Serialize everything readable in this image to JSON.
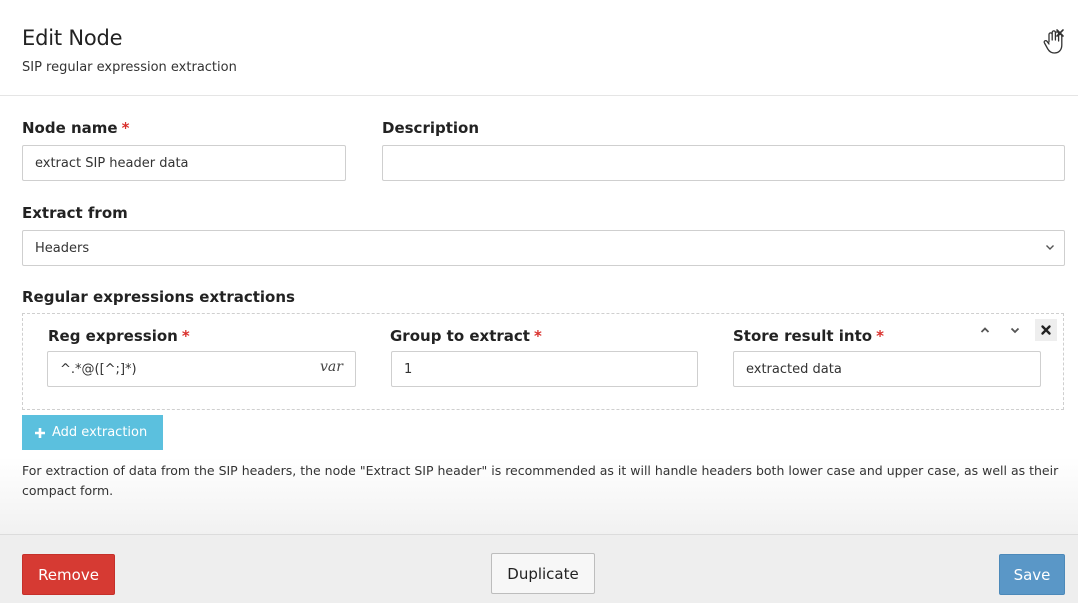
{
  "header": {
    "title": "Edit Node",
    "subtitle": "SIP regular expression extraction",
    "close_icon": "hand-pointer-close-icon"
  },
  "form": {
    "node_name": {
      "label": "Node name",
      "required_mark": "*",
      "value": "extract SIP header data"
    },
    "description": {
      "label": "Description",
      "value": ""
    },
    "extract_from": {
      "label": "Extract from",
      "selected": "Headers"
    },
    "extractions": {
      "label": "Regular expressions extractions",
      "columns": [
        {
          "label": "Reg expression",
          "required_mark": "*"
        },
        {
          "label": "Group to extract",
          "required_mark": "*"
        },
        {
          "label": "Store result into",
          "required_mark": "*"
        }
      ],
      "rows": [
        {
          "regex": "^.*@([^;]*)",
          "var_tag": "var",
          "group": "1",
          "store": "extracted data"
        }
      ],
      "add_label": "Add extraction"
    },
    "help_text": "For extraction of data from the SIP headers, the node \"Extract SIP header\" is recommended as it will handle headers both lower case and upper case, as well as their compact form."
  },
  "footer": {
    "remove_label": "Remove",
    "duplicate_label": "Duplicate",
    "save_label": "Save"
  },
  "colors": {
    "required": "#d9302c",
    "add_button": "#5bc0de",
    "remove_button": "#d63a33",
    "save_button": "#5a97c7"
  }
}
